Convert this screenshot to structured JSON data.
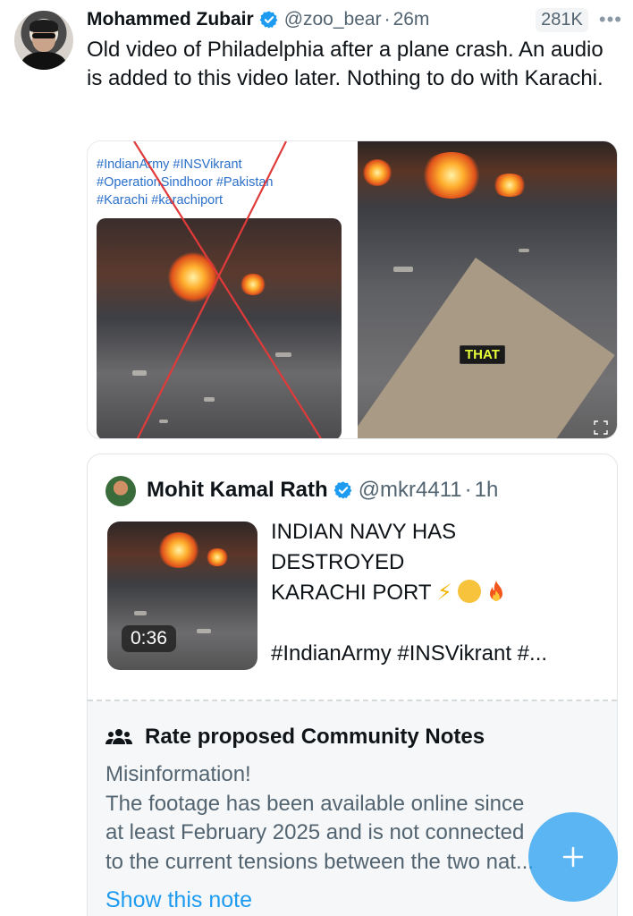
{
  "tweet": {
    "author_name": "Mohammed Zubair",
    "handle": "@zoo_bear",
    "separator": "·",
    "time": "26m",
    "views": "281K",
    "more_icon": "more-icon",
    "text": "Old video of Philadelphia after a plane crash. An audio is added to this video later. Nothing to do with Karachi.",
    "media": {
      "left_hashtags_line1": "#IndianArmy #INSVikrant",
      "left_hashtags_line2": "#OperationSindhoor #Pakistan",
      "left_hashtags_line3": "#Karachi #karachiport",
      "right_caption": "THAT"
    }
  },
  "quoted": {
    "author_name": "Mohit Kamal Rath",
    "handle": "@mkr4411",
    "separator": "·",
    "time": "1h",
    "duration": "0:36",
    "line1": "INDIAN NAVY HAS",
    "line2": "DESTROYED",
    "line3": "KARACHI PORT",
    "tags": "#IndianArmy #INSVikrant #..."
  },
  "community_notes": {
    "heading": "Rate proposed Community Notes",
    "line1": "Misinformation!",
    "line2": "The footage has been available online since",
    "line3": "at least February 2025 and is not connected",
    "line4": "to the current tensions between the two nat...",
    "show_note": "Show this note"
  },
  "fab": {
    "icon": "plus-icon"
  },
  "colors": {
    "accent": "#1d9bf0",
    "verified": "#1d9bf0",
    "muted": "#536471"
  }
}
